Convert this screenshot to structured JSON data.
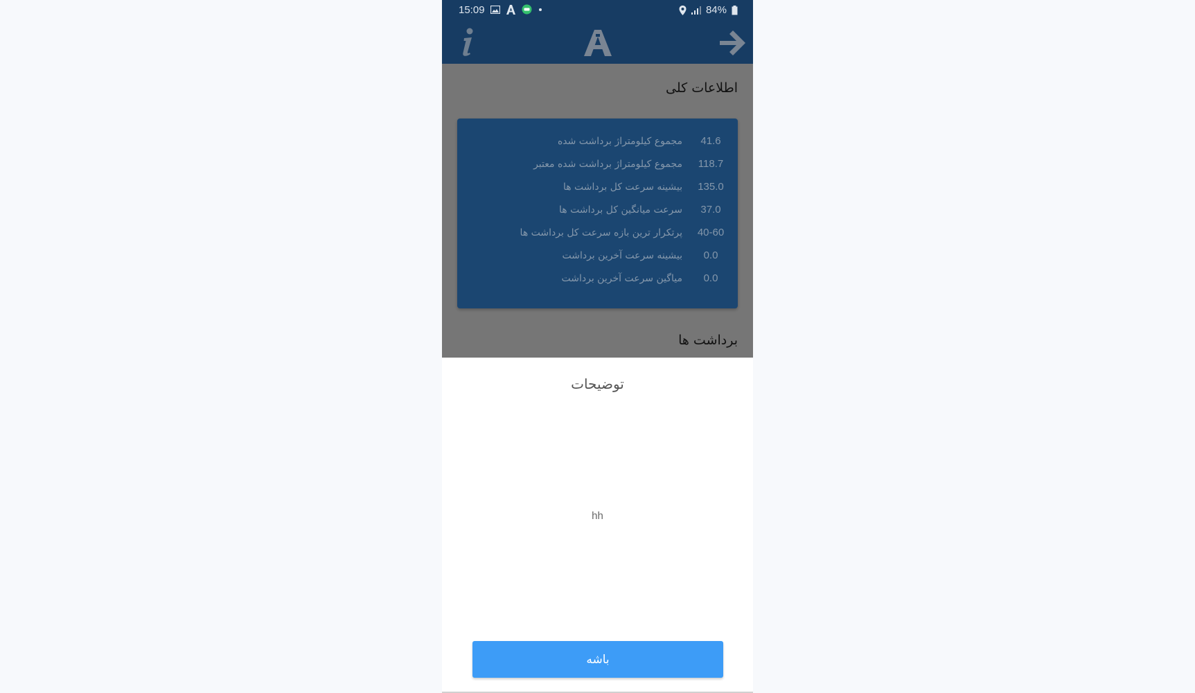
{
  "status_bar": {
    "time": "15:09",
    "battery": "84%"
  },
  "app_bar": {
    "info_icon": "info-icon",
    "logo_icon": "app-logo-icon",
    "back_icon": "arrow-right-icon"
  },
  "general_info": {
    "title": "اطلاعات کلی",
    "stats": [
      {
        "value": "41.6",
        "label": "مجموع کیلومتراژ برداشت شده"
      },
      {
        "value": "118.7",
        "label": "مجموع کیلومتراژ برداشت شده معتبر"
      },
      {
        "value": "135.0",
        "label": "بیشینه سرعت کل برداشت ها"
      },
      {
        "value": "37.0",
        "label": "سرعت میانگین کل برداشت ها"
      },
      {
        "value": "40-60",
        "label": "پرتکرار ترین بازه سرعت کل برداشت ها"
      },
      {
        "value": "0.0",
        "label": "بیشینه سرعت آخرین برداشت"
      },
      {
        "value": "0.0",
        "label": "میاگین سرعت آخرین برداشت"
      }
    ]
  },
  "recordings": {
    "title": "برداشت ها"
  },
  "dialog": {
    "title": "توضیحات",
    "body": "hh",
    "ok_label": "باشه"
  },
  "colors": {
    "app_bar": "#173c63",
    "card": "#1b4671",
    "button": "#3d9cf7"
  }
}
